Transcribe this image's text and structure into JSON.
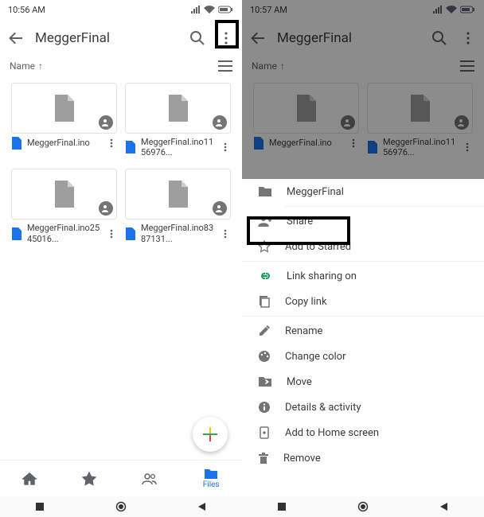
{
  "left": {
    "status": {
      "time": "10:56 AM"
    },
    "toolbar": {
      "title": "MeggerFinal"
    },
    "sort": {
      "label": "Name",
      "dir": "↑"
    },
    "files": [
      {
        "name": "MeggerFinal.ino"
      },
      {
        "name": "MeggerFinal.ino1156976..."
      },
      {
        "name": "MeggerFinal.ino2545016..."
      },
      {
        "name": "MeggerFinal.ino8387131..."
      }
    ],
    "fab": {
      "label": "+"
    },
    "tabs": {
      "files": "Files"
    }
  },
  "right": {
    "status": {
      "time": "10:57 AM"
    },
    "toolbar": {
      "title": "MeggerFinal"
    },
    "sort": {
      "label": "Name",
      "dir": "↑"
    },
    "files": [
      {
        "name": "MeggerFinal.ino"
      },
      {
        "name": "MeggerFinal.ino1156976..."
      }
    ],
    "sheet": {
      "folder": "MeggerFinal",
      "share": "Share",
      "starred": "Add to Starred",
      "linkSharing": "Link sharing on",
      "copyLink": "Copy link",
      "rename": "Rename",
      "changeColor": "Change color",
      "move": "Move",
      "details": "Details & activity",
      "addHome": "Add to Home screen",
      "remove": "Remove"
    }
  }
}
